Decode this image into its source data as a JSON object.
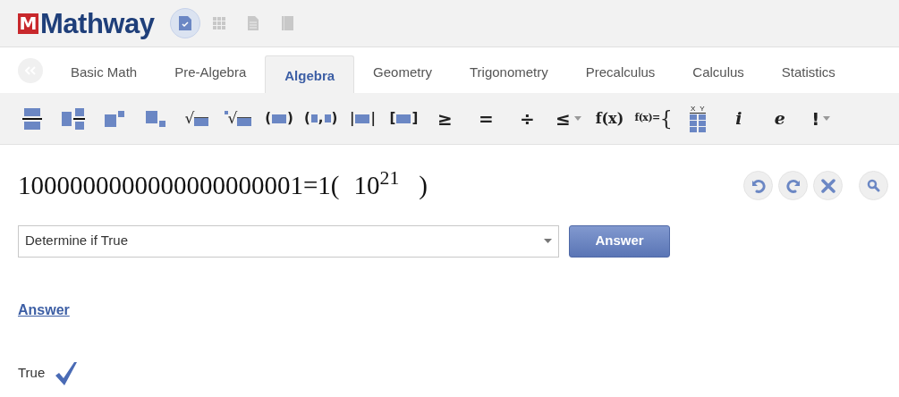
{
  "header": {
    "logo_mark": "M",
    "logo_text": "Mathway",
    "nav": [
      {
        "kind": "check",
        "selected": true
      },
      {
        "kind": "grid",
        "selected": false
      },
      {
        "kind": "page",
        "selected": false
      },
      {
        "kind": "book",
        "selected": false
      }
    ]
  },
  "tabs": [
    {
      "label": "Basic Math",
      "selected": false
    },
    {
      "label": "Pre-Algebra",
      "selected": false
    },
    {
      "label": "Algebra",
      "selected": true
    },
    {
      "label": "Geometry",
      "selected": false
    },
    {
      "label": "Trigonometry",
      "selected": false
    },
    {
      "label": "Precalculus",
      "selected": false
    },
    {
      "label": "Calculus",
      "selected": false
    },
    {
      "label": "Statistics",
      "selected": false
    }
  ],
  "toolbar": [
    {
      "kind": "fraction"
    },
    {
      "kind": "mixed"
    },
    {
      "kind": "power"
    },
    {
      "kind": "subscript"
    },
    {
      "kind": "sqrt",
      "text": "√"
    },
    {
      "kind": "nthroot",
      "text": "√"
    },
    {
      "kind": "paren",
      "text": "(",
      "close": ")"
    },
    {
      "kind": "pair",
      "text": "(",
      "close": ")",
      "sep": ","
    },
    {
      "kind": "abs",
      "text": "|",
      "close": "|"
    },
    {
      "kind": "bracket",
      "text": "[",
      "close": "]"
    },
    {
      "kind": "symbol",
      "text": "≥"
    },
    {
      "kind": "symbol",
      "text": "="
    },
    {
      "kind": "symbol",
      "text": "÷"
    },
    {
      "kind": "symbol",
      "text": "≤",
      "menu": true
    },
    {
      "kind": "func",
      "text": "f(x)"
    },
    {
      "kind": "piecewise",
      "text": "f(x)=",
      "close": "{"
    },
    {
      "kind": "table",
      "text": "X",
      "close": "Y"
    },
    {
      "kind": "italic",
      "text": "i"
    },
    {
      "kind": "italic",
      "text": "e"
    },
    {
      "kind": "symbol",
      "text": "!",
      "menu": true
    }
  ],
  "expression": {
    "lhs": "1000000000000000000001=1(",
    "inner": "10$^{21}$",
    "close": ")"
  },
  "actions": [
    {
      "kind": "undo"
    },
    {
      "kind": "redo"
    },
    {
      "kind": "clear"
    },
    {
      "kind": "search"
    }
  ],
  "problem_type": {
    "value": "Determine if True"
  },
  "answer_button": "Answer",
  "answer_heading": "Answer",
  "result": {
    "text": "True",
    "correct": true
  }
}
